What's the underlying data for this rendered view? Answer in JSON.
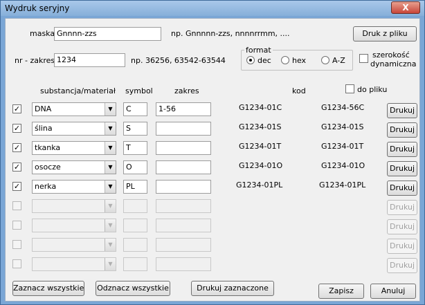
{
  "window": {
    "title": "Wydruk seryjny",
    "close": "X"
  },
  "mask": {
    "label": "maska",
    "value": "Gnnnn-zzs",
    "hint": "np. Gnnnnn-zzs,  nnnnrrmm, ...."
  },
  "range": {
    "label": "nr - zakres",
    "value": "1234",
    "hint": "np.  36256, 63542-63544"
  },
  "print_file_button": "Druk z pliku",
  "format": {
    "title": "format",
    "options": [
      {
        "label": "dec",
        "selected": true
      },
      {
        "label": "hex",
        "selected": false
      },
      {
        "label": "A-Z",
        "selected": false
      }
    ]
  },
  "dynamic_width": {
    "label_line1": "szerokość",
    "label_line2": "dynamiczna",
    "checked": false
  },
  "table": {
    "headers": {
      "substance": "substancja/materiał",
      "symbol": "symbol",
      "range": "zakres",
      "code": "kod",
      "to_file": "do pliku"
    },
    "rows": [
      {
        "checked": true,
        "substance": "DNA",
        "symbol": "C",
        "range": "1-56",
        "code_from": "G1234-01C",
        "code_to": "G1234-56C",
        "print": "Drukuj",
        "enabled": true
      },
      {
        "checked": true,
        "substance": "ślina",
        "symbol": "S",
        "range": "",
        "code_from": "G1234-01S",
        "code_to": "G1234-01S",
        "print": "Drukuj",
        "enabled": true
      },
      {
        "checked": true,
        "substance": "tkanka",
        "symbol": "T",
        "range": "",
        "code_from": "G1234-01T",
        "code_to": "G1234-01T",
        "print": "Drukuj",
        "enabled": true
      },
      {
        "checked": true,
        "substance": "osocze",
        "symbol": "O",
        "range": "",
        "code_from": "G1234-01O",
        "code_to": "G1234-01O",
        "print": "Drukuj",
        "enabled": true
      },
      {
        "checked": true,
        "substance": "nerka",
        "symbol": "PL",
        "range": "",
        "code_from": "G1234-01PL",
        "code_to": "G1234-01PL",
        "print": "Drukuj",
        "enabled": true
      },
      {
        "checked": false,
        "substance": "",
        "symbol": "",
        "range": "",
        "code_from": "",
        "code_to": "",
        "print": "Drukuj",
        "enabled": false
      },
      {
        "checked": false,
        "substance": "",
        "symbol": "",
        "range": "",
        "code_from": "",
        "code_to": "",
        "print": "Drukuj",
        "enabled": false
      },
      {
        "checked": false,
        "substance": "",
        "symbol": "",
        "range": "",
        "code_from": "",
        "code_to": "",
        "print": "Drukuj",
        "enabled": false
      },
      {
        "checked": false,
        "substance": "",
        "symbol": "",
        "range": "",
        "code_from": "",
        "code_to": "",
        "print": "Drukuj",
        "enabled": false
      }
    ]
  },
  "footer": {
    "select_all": "Zaznacz wszystkie",
    "deselect_all": "Odznacz wszystkie",
    "print_selected": "Drukuj zaznaczone",
    "save": "Zapisz",
    "cancel": "Anuluj"
  }
}
